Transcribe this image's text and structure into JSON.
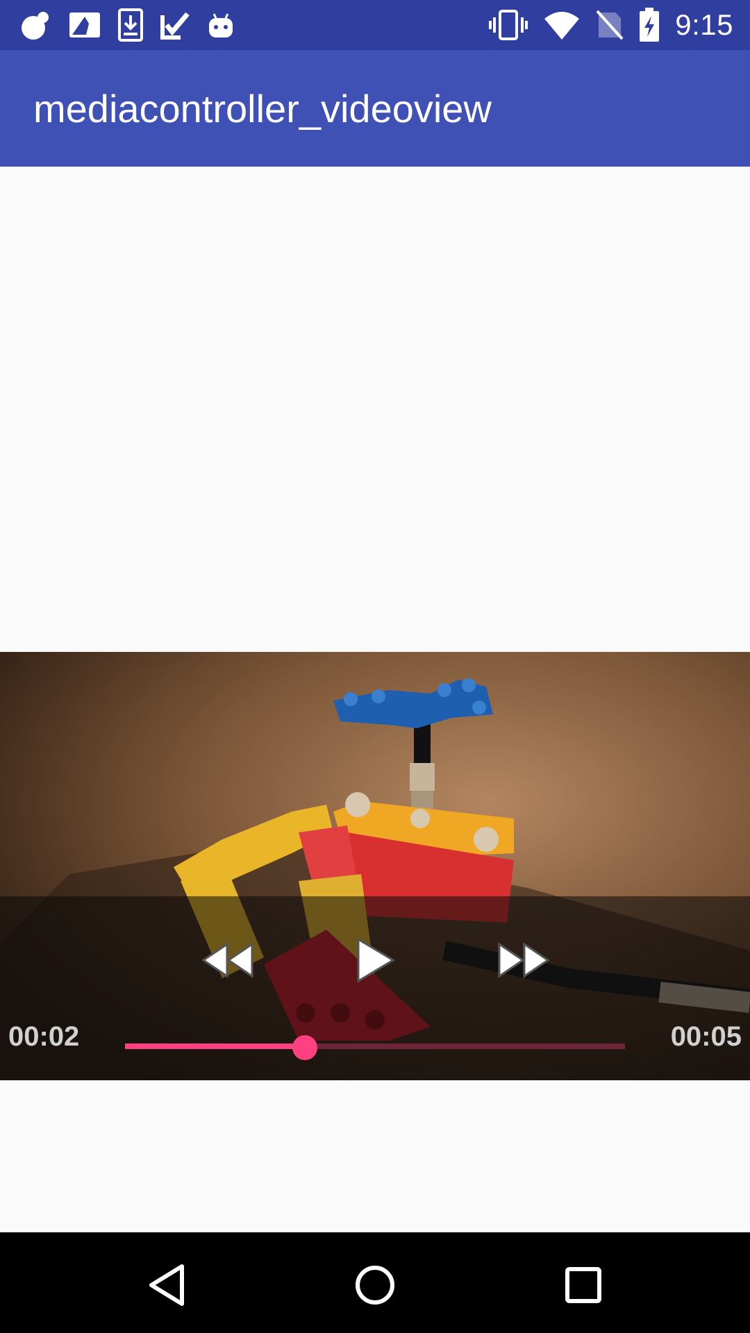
{
  "status_bar": {
    "time": "9:15",
    "left_icons": [
      "notification-blob-icon",
      "photo-icon",
      "download-icon",
      "checklist-icon",
      "android-icon"
    ],
    "right_icons": [
      "vibrate-icon",
      "wifi-icon",
      "no-sim-icon",
      "battery-charging-icon"
    ]
  },
  "app_bar": {
    "title": "mediacontroller_videoview",
    "color": "#3f51b5",
    "status_color": "#303f9f"
  },
  "media_controller": {
    "current_time": "00:02",
    "total_time": "00:05",
    "progress": 0.36,
    "accent_color": "#ff4081",
    "buttons": [
      "rewind-icon",
      "play-icon",
      "fast-forward-icon"
    ]
  },
  "nav_bar": {
    "buttons": [
      "back-icon",
      "home-icon",
      "recents-icon"
    ]
  }
}
